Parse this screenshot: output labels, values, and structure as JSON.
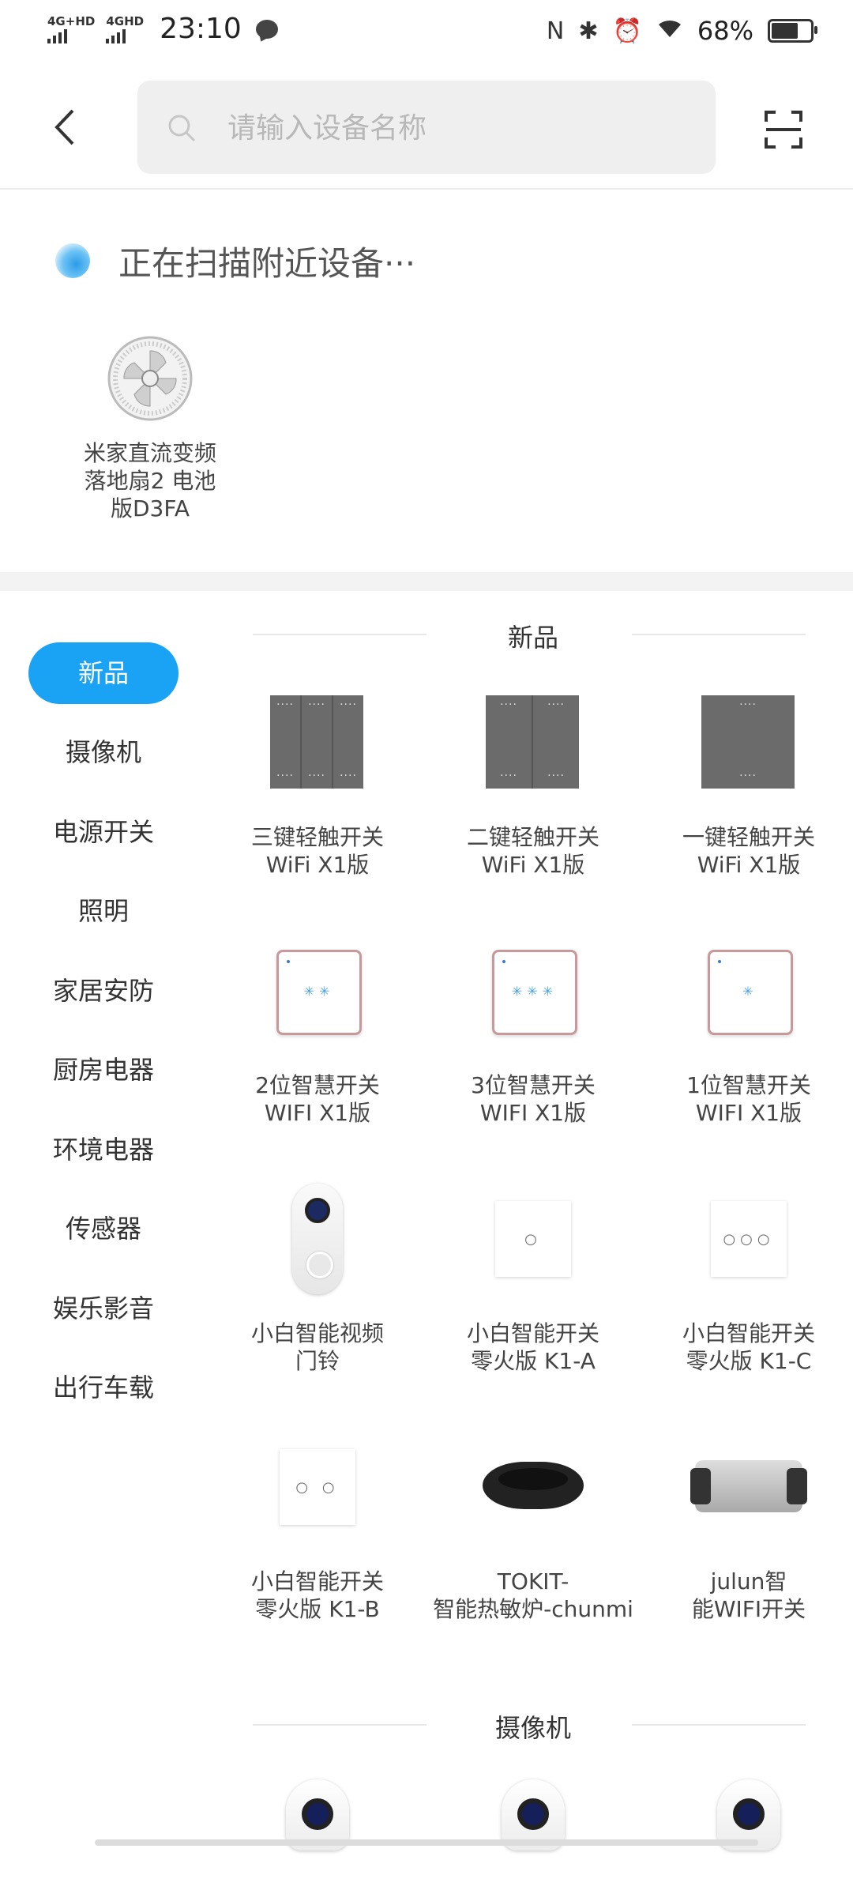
{
  "status_bar": {
    "network1": "4G+HD",
    "network2": "4GHD",
    "time": "23:10",
    "battery": "68%",
    "battery_level": 0.68
  },
  "header": {
    "search_placeholder": "请输入设备名称"
  },
  "nearby": {
    "scanning_text": "正在扫描附近设备···",
    "devices": [
      {
        "name": "米家直流变频\n落地扇2 电池\n版D3FA"
      }
    ]
  },
  "categories": [
    {
      "label": "新品",
      "active": true
    },
    {
      "label": "摄像机"
    },
    {
      "label": "电源开关"
    },
    {
      "label": "照明"
    },
    {
      "label": "家居安防"
    },
    {
      "label": "厨房电器"
    },
    {
      "label": "环境电器"
    },
    {
      "label": "传感器"
    },
    {
      "label": "娱乐影音"
    },
    {
      "label": "出行车载"
    }
  ],
  "sections": [
    {
      "title": "新品",
      "items": [
        {
          "name": "三键轻触开关\nWiFi X1版",
          "icon": "triple-gray-switch"
        },
        {
          "name": "二键轻触开关\nWiFi X1版",
          "icon": "double-gray-switch"
        },
        {
          "name": "一键轻触开关\nWiFi X1版",
          "icon": "single-gray-switch"
        },
        {
          "name": "2位智慧开关\nWIFI X1版",
          "icon": "two-gang-white-switch"
        },
        {
          "name": "3位智慧开关\nWIFI X1版",
          "icon": "three-gang-white-switch"
        },
        {
          "name": "1位智慧开关\nWIFI X1版",
          "icon": "one-gang-white-switch"
        },
        {
          "name": "小白智能视频\n门铃",
          "icon": "video-doorbell"
        },
        {
          "name": "小白智能开关\n零火版 K1-A",
          "icon": "k1-switch-one"
        },
        {
          "name": "小白智能开关\n零火版 K1-C",
          "icon": "k1-switch-three"
        },
        {
          "name": "小白智能开关\n零火版 K1-B",
          "icon": "k1-switch-two"
        },
        {
          "name": "TOKIT-\n智能热敏炉-chunmi",
          "icon": "induction-cooker"
        },
        {
          "name": "julun智\n能WIFI开关",
          "icon": "julun-wifi-switch"
        }
      ]
    },
    {
      "title": "摄像机",
      "items": [
        {
          "icon": "camera"
        },
        {
          "icon": "camera"
        },
        {
          "icon": "camera"
        }
      ]
    }
  ]
}
